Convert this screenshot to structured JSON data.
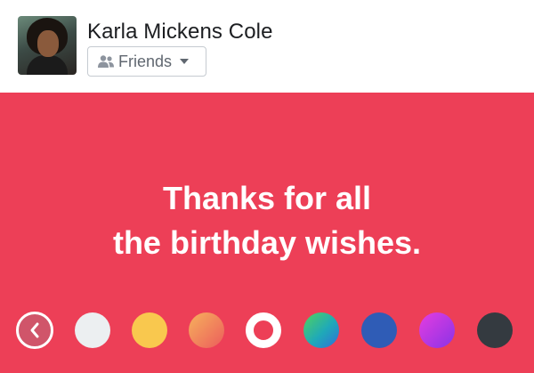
{
  "composer": {
    "user_name": "Karla Mickens Cole",
    "audience_label": "Friends",
    "audience_icon": "friends-icon",
    "avatar_icon": "profile-photo"
  },
  "post": {
    "text_line1": "Thanks for all",
    "text_line2": "the birthday wishes.",
    "background_color": "#ed3f57",
    "text_color": "#ffffff"
  },
  "background_palette": {
    "back_icon": "chevron-left-icon",
    "swatches": [
      {
        "name": "white",
        "color": "#eceff1"
      },
      {
        "name": "yellow",
        "color": "#f9c84e"
      },
      {
        "name": "orange-gradient",
        "color": "#f27a56"
      },
      {
        "name": "red-selected",
        "color": "#ed3f57",
        "selected": true
      },
      {
        "name": "green-blue-gradient",
        "color": "#24b3a4"
      },
      {
        "name": "blue",
        "color": "#2f5cb6"
      },
      {
        "name": "purple-gradient",
        "color": "#b533e0"
      },
      {
        "name": "dark-gray",
        "color": "#343a40"
      }
    ]
  }
}
